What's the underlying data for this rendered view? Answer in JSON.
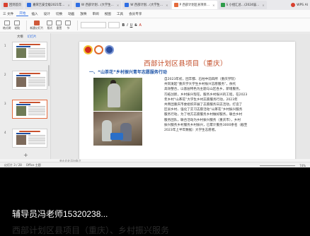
{
  "tabs": [
    {
      "label": "回到首页",
      "color": "#d8402f",
      "active": false
    },
    {
      "label": "嘉荣吉安全级2021年…",
      "color": "#2f6ee3",
      "active": false
    },
    {
      "label": "W 西部计划…(大学生…",
      "color": "#2f6ee3",
      "active": false
    },
    {
      "label": "W 西部计划…(大学生…",
      "color": "#2f6ee3",
      "active": false
    },
    {
      "label": "P 西部计划区县项目…",
      "color": "#e46a3c",
      "active": true
    },
    {
      "label": "S 小组汇总…(2024届…",
      "color": "#2f9c4a",
      "active": false
    }
  ],
  "wps_label": "WPS AI",
  "menu": [
    "三 文件",
    "开始",
    "插入",
    "设计",
    "切换",
    "动画",
    "放映",
    "审阅",
    "视图",
    "工具",
    "会员专享"
  ],
  "menu_active_index": 1,
  "ribbon": [
    "格式刷",
    "粘贴",
    "新建幻灯片",
    "版式",
    "重置",
    "节"
  ],
  "ribbon_right": [
    "B",
    "I",
    "U",
    "S",
    "A"
  ],
  "left_tabs": [
    "大纲",
    "幻灯片"
  ],
  "left_active_tab": 1,
  "thumb_numbers": [
    "1",
    "2",
    "3",
    "4"
  ],
  "slide": {
    "title": "西部计划区县项目（重庆）",
    "subtitle": "一、“山茶花”乡村振兴青年志愿服务行动",
    "body_lines": [
      "自2023年初，团丰都、石柱中前四所（重庆学院）",
      "共同发起“重庆学大学生乡村振兴志愿服务”，依托",
      "高效整合，以基层特色为主题与山区各乡，新增服务，",
      "巧拓创新，乡村振兴现在，服务乡村振兴的工程，在2023",
      "年乡村“山茶花”大学生乡村志愿服务行动，2023年",
      "共青团重庆市委组织开展了志愿服务日志活动，打造了",
      "区县乡村、强化了实习志愿活动“山茶花”乡村振兴服务",
      "服务行动，为了地方志愿服务乡村做好服务，联合乡村",
      "服务团队，联合活动为乡村振兴服务（重庆市），乡村",
      "振兴服务乡村服务乡村振兴，已累计服务3000余名（截至",
      "2023年上半年数据）大学生志愿者。"
    ]
  },
  "notes_placeholder": "单击此处添加备注",
  "status": {
    "slide_info": "幻灯片 3 / 28",
    "theme": "Office 主题",
    "zoom": "74%"
  },
  "caption": "辅导员冯老师15320238...",
  "ghost_caption": "西部计划区县项目（重庆）、乡村振兴服务"
}
